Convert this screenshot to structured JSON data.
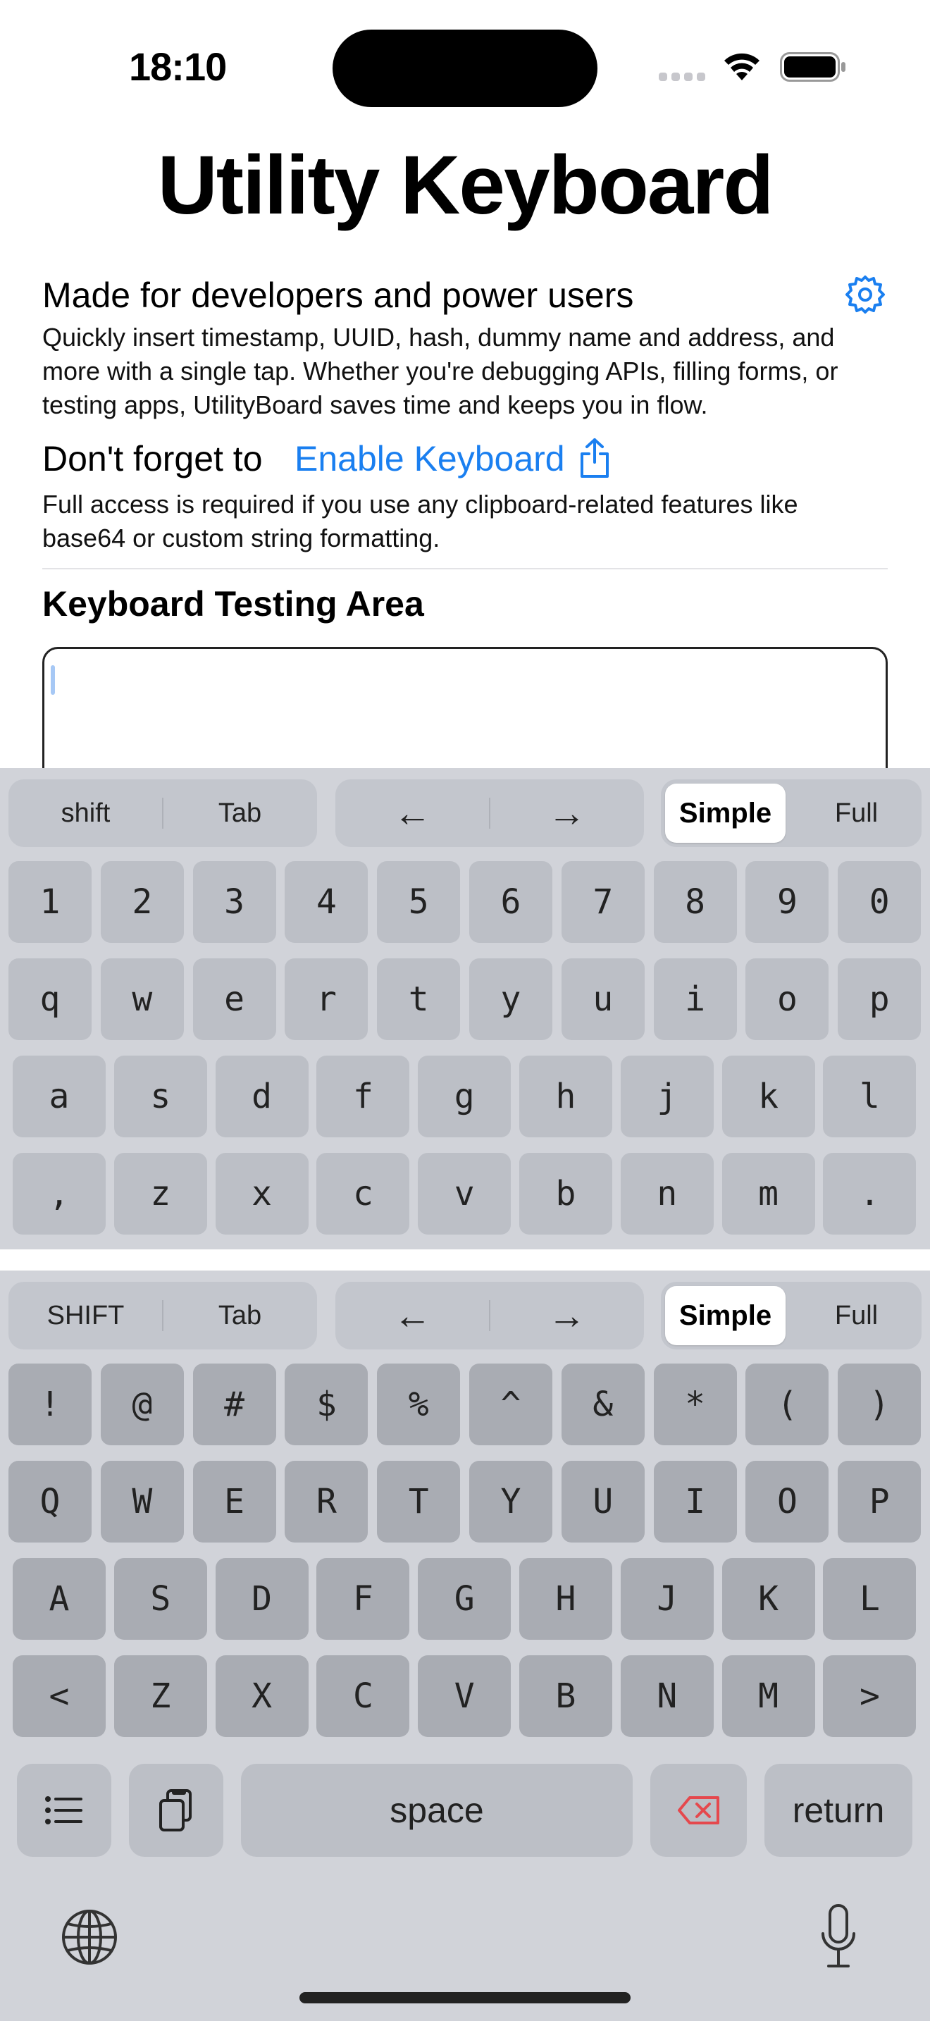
{
  "status_bar": {
    "time": "18:10"
  },
  "app": {
    "title": "Utility Keyboard",
    "subheading": "Made for developers and power users",
    "description": "Quickly insert timestamp, UUID, hash, dummy name and address, and more with a single tap. Whether you're debugging APIs, filling forms, or testing apps, UtilityBoard saves time and keeps you in flow.",
    "reminder_prefix": "Don't forget to",
    "enable_link": "Enable Keyboard",
    "full_access_note": "Full access is required if you use any clipboard-related features like base64 or custom string formatting.",
    "testing_area_title": "Keyboard Testing Area"
  },
  "keyboard_lower": {
    "toolbar": {
      "shift": "shift",
      "tab": "Tab",
      "left": "←",
      "right": "→",
      "simple": "Simple",
      "full": "Full",
      "selected_mode": "Simple"
    },
    "row_digits": [
      "1",
      "2",
      "3",
      "4",
      "5",
      "6",
      "7",
      "8",
      "9",
      "0"
    ],
    "row_q": [
      "q",
      "w",
      "e",
      "r",
      "t",
      "y",
      "u",
      "i",
      "o",
      "p"
    ],
    "row_a": [
      "a",
      "s",
      "d",
      "f",
      "g",
      "h",
      "j",
      "k",
      "l"
    ],
    "row_z": [
      ",",
      "z",
      "x",
      "c",
      "v",
      "b",
      "n",
      "m",
      "."
    ]
  },
  "keyboard_upper": {
    "toolbar": {
      "shift": "SHIFT",
      "tab": "Tab",
      "left": "←",
      "right": "→",
      "simple": "Simple",
      "full": "Full",
      "selected_mode": "Simple"
    },
    "row_symbols": [
      "!",
      "@",
      "#",
      "$",
      "%",
      "^",
      "&",
      "*",
      "(",
      ")"
    ],
    "row_q": [
      "Q",
      "W",
      "E",
      "R",
      "T",
      "Y",
      "U",
      "I",
      "O",
      "P"
    ],
    "row_a": [
      "A",
      "S",
      "D",
      "F",
      "G",
      "H",
      "J",
      "K",
      "L"
    ],
    "row_z": [
      "<",
      "Z",
      "X",
      "C",
      "V",
      "B",
      "N",
      "M",
      ">"
    ],
    "bottom_row": {
      "space": "space",
      "return": "return"
    }
  },
  "icons": {
    "gear": "gear-icon",
    "share": "share-icon",
    "list": "list-icon",
    "clipboard": "clipboard-icon",
    "delete": "delete-icon",
    "globe": "globe-icon",
    "mic": "microphone-icon",
    "wifi": "wifi-icon",
    "battery": "battery-icon"
  },
  "colors": {
    "accent": "#1a7ff0",
    "delete": "#e5484d",
    "keyboard_bg": "#d1d3d9"
  }
}
